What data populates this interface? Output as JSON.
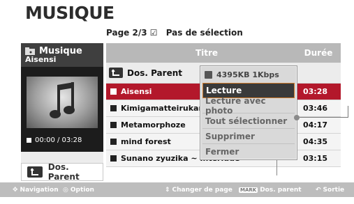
{
  "app": {
    "title": "MUSIQUE"
  },
  "header": {
    "page": "Page 2/3",
    "selection": "Pas de sélection"
  },
  "left_panel": {
    "folder_label": "Musique",
    "item_name": "Aisensi",
    "time": "00:00 / 03:28",
    "parent_button": "Dos. Parent"
  },
  "table": {
    "col_title": "Titre",
    "col_duration": "Durée",
    "parent_row": "Dos. Parent",
    "rows": [
      {
        "name": "Aisensi",
        "duration": "03:28"
      },
      {
        "name": "Kimigamatteirukara",
        "duration": "03:46"
      },
      {
        "name": "Metamorphoze",
        "duration": "04:17"
      },
      {
        "name": "mind forest",
        "duration": "04:35"
      },
      {
        "name": "Sunano zyuzika ~ Interlude ~",
        "duration": "03:15"
      }
    ]
  },
  "popup": {
    "info": "4395KB 1Kbps",
    "items": [
      "Lecture",
      "Lecture avec photo",
      "Tout sélectionner",
      "Supprimer",
      "Fermer"
    ]
  },
  "footer": {
    "navigation": "Navigation",
    "option": "Option",
    "change_page": "Changer de page",
    "mark": "MARK",
    "parent": "Dos. parent",
    "exit": "Sortie"
  },
  "colors": {
    "accent": "#b3182b",
    "header_bar": "#b8b8b8",
    "footer_bar": "#bdbdbd"
  }
}
